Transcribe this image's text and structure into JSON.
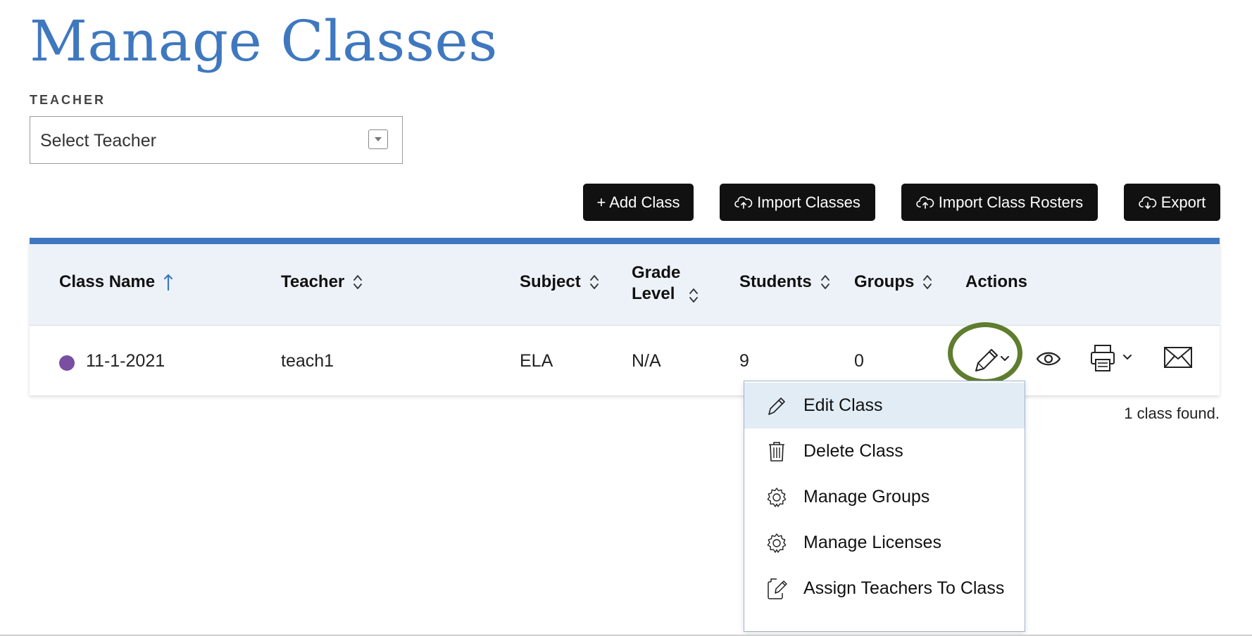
{
  "page": {
    "title": "Manage Classes"
  },
  "filter": {
    "label": "TEACHER",
    "select_value": "Select Teacher"
  },
  "toolbar": {
    "add_class": "+ Add Class",
    "import_classes": "Import Classes",
    "import_rosters": "Import Class Rosters",
    "export": "Export"
  },
  "table": {
    "headers": {
      "class_name": "Class Name",
      "teacher": "Teacher",
      "subject": "Subject",
      "grade_level_line1": "Grade",
      "grade_level_line2": "Level",
      "students": "Students",
      "groups": "Groups",
      "actions": "Actions"
    },
    "rows": [
      {
        "class_name": "11-1-2021",
        "teacher": "teach1",
        "subject": "ELA",
        "grade_level": "N/A",
        "students": "9",
        "groups": "0",
        "dot_color": "#7a4ea0"
      }
    ],
    "found_text": "1 class found."
  },
  "actions_menu": {
    "items": [
      {
        "label": "Edit Class",
        "icon": "pencil-icon"
      },
      {
        "label": "Delete Class",
        "icon": "trash-icon"
      },
      {
        "label": "Manage Groups",
        "icon": "gear-icon"
      },
      {
        "label": "Manage Licenses",
        "icon": "gear-icon"
      },
      {
        "label": "Assign Teachers To Class",
        "icon": "assign-icon"
      }
    ]
  },
  "colors": {
    "title": "#3f78bf",
    "accent_bar": "#3f78bf",
    "highlight_ring": "#5f7d2e",
    "menu_active_bg": "#e2ecf4"
  }
}
